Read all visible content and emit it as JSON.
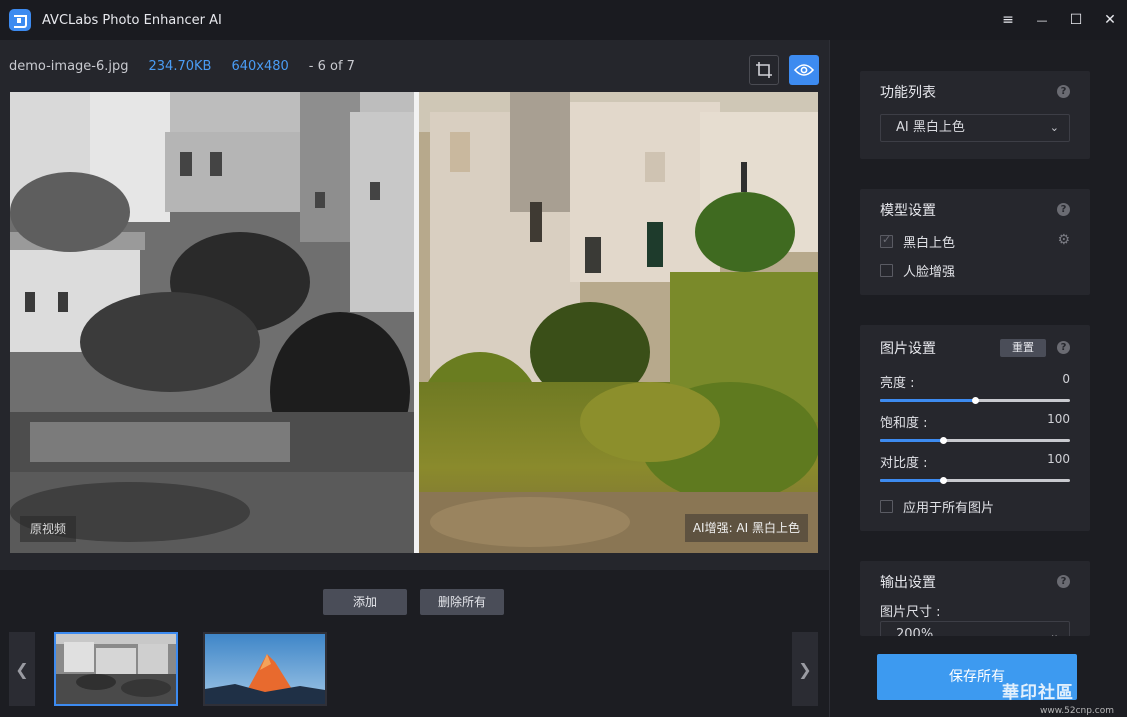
{
  "app": {
    "title": "AVCLabs Photo Enhancer AI"
  },
  "window_controls": {
    "menu": "≡",
    "minimize": "—",
    "maximize": "☐",
    "close": "✕"
  },
  "file_info": {
    "name": "demo-image-6.jpg",
    "size": "234.70KB",
    "resolution": "640x480",
    "index": "- 6 of 7"
  },
  "preview": {
    "left_tag": "原视频",
    "right_tag": "AI增强: AI 黑白上色"
  },
  "actions": {
    "add": "添加",
    "delete_all": "删除所有"
  },
  "thumbnails": [
    {
      "name": "village",
      "active": true
    },
    {
      "name": "mountain",
      "active": false
    }
  ],
  "panel": {
    "function_list": {
      "title": "功能列表",
      "selected": "AI 黑白上色"
    },
    "model": {
      "title": "模型设置",
      "options": [
        {
          "label": "黑白上色",
          "checked": true
        },
        {
          "label": "人脸增强",
          "checked": false
        }
      ]
    },
    "image": {
      "title": "图片设置",
      "reset": "重置",
      "sliders": [
        {
          "label": "亮度 :",
          "value": "0",
          "level": 0.5
        },
        {
          "label": "饱和度 :",
          "value": "100",
          "level": 0.33
        },
        {
          "label": "对比度 :",
          "value": "100",
          "level": 0.33
        }
      ],
      "apply_all": "应用于所有图片"
    },
    "output": {
      "title": "输出设置",
      "size_label": "图片尺寸 :",
      "size_value": "200%"
    },
    "save": "保存所有"
  },
  "watermark": {
    "main": "華印社區",
    "sub": "www.52cnp.com"
  },
  "colors": {
    "accent": "#3d8bf0",
    "panel": "#26272d",
    "background": "#1c1d22"
  }
}
